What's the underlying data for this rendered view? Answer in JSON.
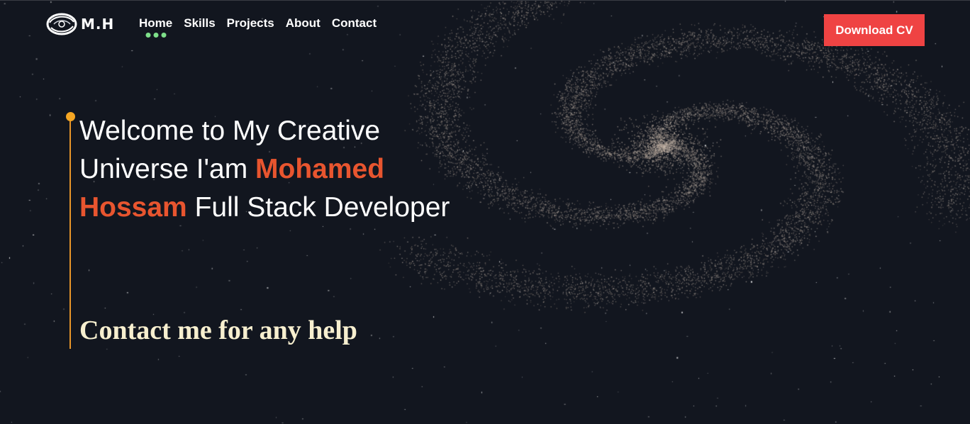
{
  "nav": {
    "logo_text": "M.H",
    "links": [
      {
        "label": "Home",
        "active": true
      },
      {
        "label": "Skills"
      },
      {
        "label": "Projects"
      },
      {
        "label": "About"
      },
      {
        "label": "Contact"
      }
    ],
    "cta_label": "Download CV"
  },
  "hero": {
    "line1": "Welcome to My Creative",
    "line2_prefix": "Universe I'am ",
    "name": "Mohamed Hossam",
    "suffix": " Full Stack Developer",
    "tagline": "Contact me for any help"
  },
  "colors": {
    "background": "#12161f",
    "cta": "#ef4343",
    "name_accent": "#e8552f",
    "timeline_accent": "#f5a623",
    "active_dots": "#7ee08a",
    "tagline": "#f7efcf"
  }
}
